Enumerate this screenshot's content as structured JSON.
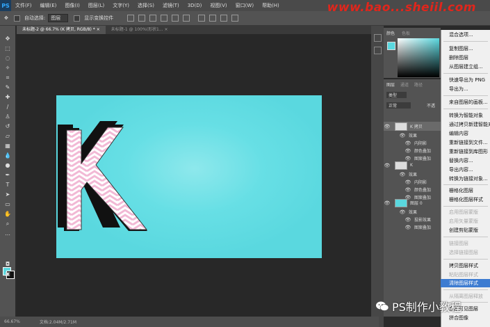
{
  "menubar": {
    "app_logo": "PS",
    "items": [
      "文件(F)",
      "编辑(E)",
      "图像(I)",
      "图层(L)",
      "文字(Y)",
      "选择(S)",
      "滤镜(T)",
      "3D(D)",
      "视图(V)",
      "窗口(W)",
      "帮助(H)"
    ]
  },
  "watermark_top": "www.bao...shejil.com",
  "options": {
    "auto_select_label": "自动选择:",
    "auto_select_value": "图层",
    "show_transform_label": "显示变换控件"
  },
  "tabs": [
    {
      "label": "未标题-2 @ 66.7% (K 拷贝, RGB/8) *"
    },
    {
      "label": "未标题-1 @ 100%(形状1..."
    }
  ],
  "color_panel": {
    "tab1": "颜色",
    "tab2": "色板"
  },
  "layers_panel": {
    "tabs": [
      "图层",
      "通道",
      "路径"
    ],
    "filter_label": "类型",
    "blend_mode": "正常",
    "opacity_label": "不透",
    "layers": [
      {
        "name": "K 拷贝",
        "kind": "layer",
        "selected": true
      },
      {
        "name": "效果",
        "kind": "fx"
      },
      {
        "name": "内阴影",
        "kind": "effect"
      },
      {
        "name": "颜色叠加",
        "kind": "effect"
      },
      {
        "name": "图案叠加",
        "kind": "effect"
      },
      {
        "name": "K",
        "kind": "layer"
      },
      {
        "name": "效果",
        "kind": "fx"
      },
      {
        "name": "内阴影",
        "kind": "effect"
      },
      {
        "name": "颜色叠加",
        "kind": "effect"
      },
      {
        "name": "图案叠加",
        "kind": "effect"
      },
      {
        "name": "图层 0",
        "kind": "layer"
      },
      {
        "name": "效果",
        "kind": "fx"
      },
      {
        "name": "投影效果",
        "kind": "effect"
      },
      {
        "name": "图案叠加",
        "kind": "effect"
      }
    ]
  },
  "context_menu": {
    "items": [
      {
        "label": "混合选项...",
        "state": "normal"
      },
      {
        "label": "复制图层...",
        "state": "normal"
      },
      {
        "label": "删除图层",
        "state": "normal"
      },
      {
        "label": "从图层建立组...",
        "state": "normal"
      },
      {
        "label": "快速导出为 PNG",
        "state": "normal"
      },
      {
        "label": "导出为...",
        "state": "normal"
      },
      {
        "label": "来自图层的画板...",
        "state": "normal"
      },
      {
        "label": "转换为智能对象",
        "state": "normal"
      },
      {
        "label": "通过拷贝新建智能对象",
        "state": "normal"
      },
      {
        "label": "编辑内容",
        "state": "normal"
      },
      {
        "label": "重新链接到文件...",
        "state": "normal"
      },
      {
        "label": "重新链接到库图形",
        "state": "normal"
      },
      {
        "label": "替换内容...",
        "state": "normal"
      },
      {
        "label": "导出内容...",
        "state": "normal"
      },
      {
        "label": "转换为链接对象...",
        "state": "normal"
      },
      {
        "label": "栅格化图层",
        "state": "normal"
      },
      {
        "label": "栅格化图层样式",
        "state": "normal"
      },
      {
        "label": "启用图层蒙版",
        "state": "disabled"
      },
      {
        "label": "启用矢量蒙版",
        "state": "disabled"
      },
      {
        "label": "创建剪贴蒙版",
        "state": "normal"
      },
      {
        "label": "链接图层",
        "state": "disabled"
      },
      {
        "label": "选择链接图层",
        "state": "disabled"
      },
      {
        "label": "拷贝图层样式",
        "state": "normal"
      },
      {
        "label": "粘贴图层样式",
        "state": "disabled"
      },
      {
        "label": "清除图层样式",
        "state": "highlighted"
      },
      {
        "label": "从隔离图层释放",
        "state": "disabled"
      },
      {
        "label": "合并可见图层",
        "state": "normal"
      },
      {
        "label": "拼合图像",
        "state": "normal"
      }
    ]
  },
  "canvas": {
    "letter": "K",
    "bg_color": "#5ad8df",
    "pattern_color": "#f2b9d5"
  },
  "status": {
    "zoom": "66.67%",
    "doc_info": "文档:2.04M/2.71M"
  },
  "watermark_bottom": "PS制作小教程",
  "colors": {
    "accent": "#3d7cd1",
    "canvas_cyan": "#5ad8df",
    "panel": "#535353"
  }
}
